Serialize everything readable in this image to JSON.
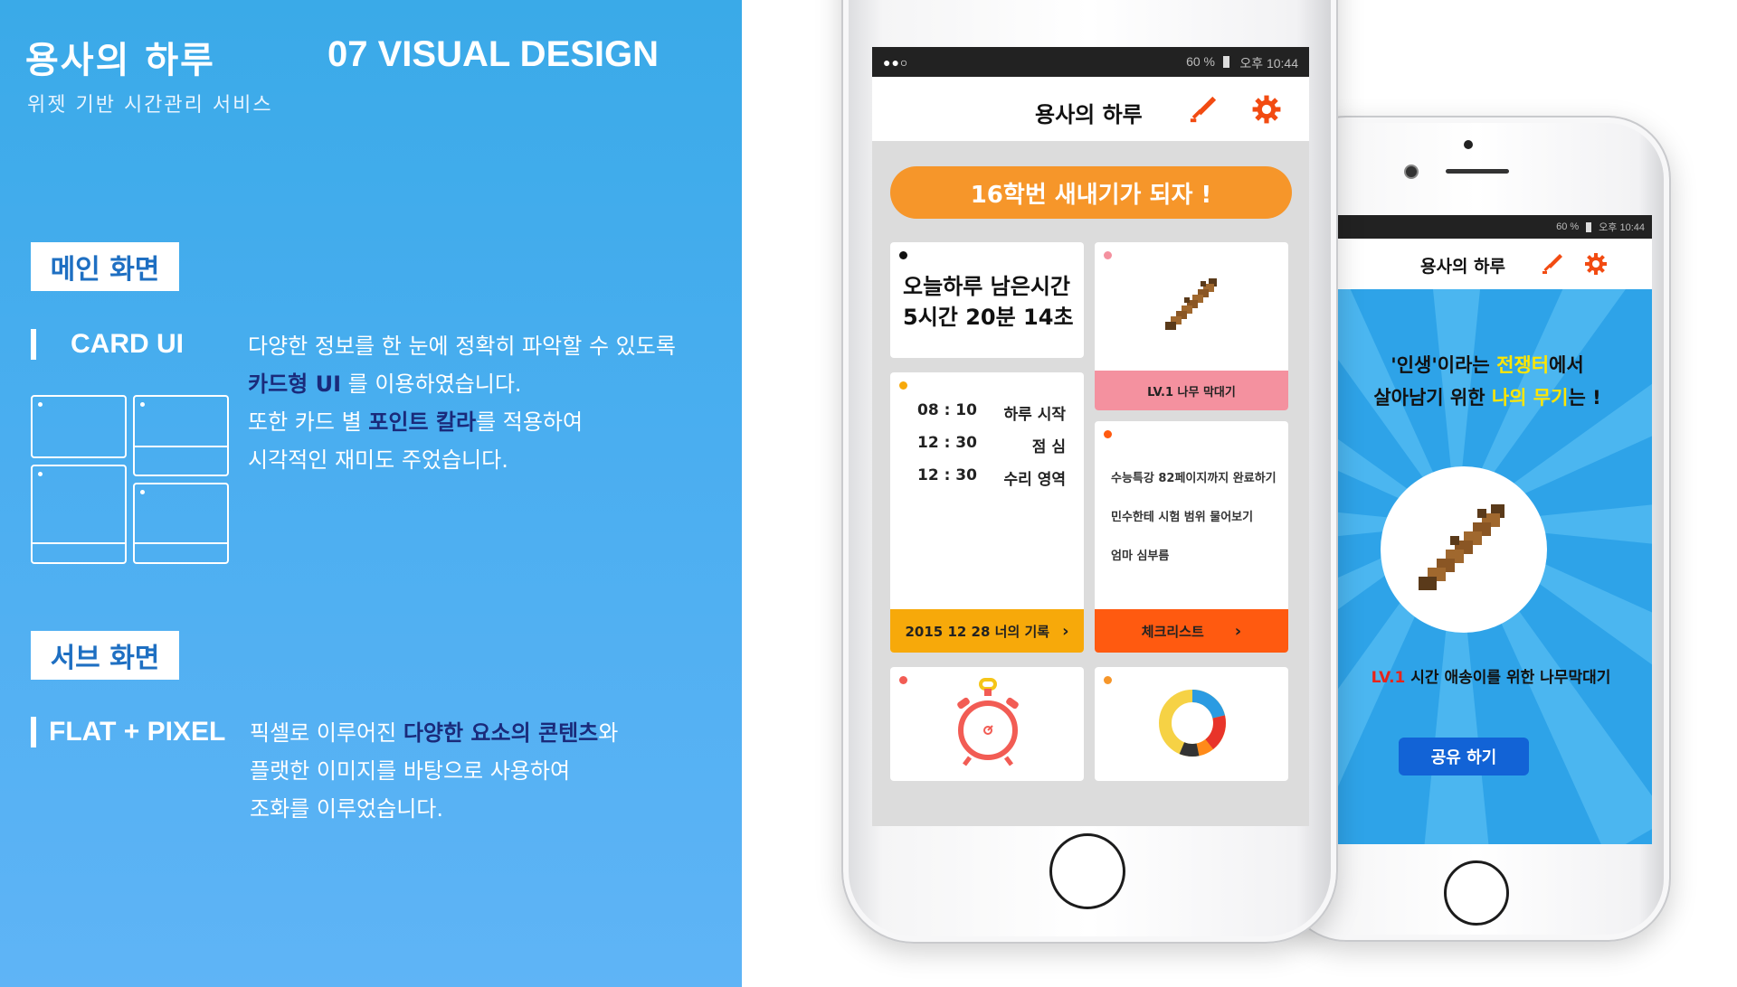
{
  "header": {
    "app_name": "용사의 하루",
    "section": "07 VISUAL DESIGN",
    "subtitle": "위젯 기반 시간관리 서비스"
  },
  "main_section": {
    "tag": "메인 화면",
    "feature": "CARD UI",
    "desc_l1": "다양한 정보를 한 눈에 정확히 파악할 수 있도록",
    "desc_l2_hl": "카드형 UI",
    "desc_l2_rest": " 를 이용하였습니다.",
    "desc_l3_pre": "또한 카드 별 ",
    "desc_l3_hl": "포인트 칼라",
    "desc_l3_rest": "를 적용하여",
    "desc_l4": "시각적인 재미도 주었습니다."
  },
  "sub_section": {
    "tag": "서브 화면",
    "feature": "FLAT + PIXEL",
    "desc_l1_pre": "픽셀로 이루어진 ",
    "desc_l1_hl": "다양한 요소의 콘텐츠",
    "desc_l1_rest": "와",
    "desc_l2": "플랫한 이미지를 바탕으로 사용하여",
    "desc_l3": "조화를 이루었습니다."
  },
  "phone_main": {
    "status_battery": "60 %",
    "status_time": "오후 10:44",
    "title": "용사의 하루",
    "banner": "16학번 새내기가 되자 !",
    "remaining_label": "오늘하루 남은시간",
    "remaining_value": "5시간 20분 14초",
    "weapon_label": "LV.1 나무 막대기",
    "schedule": [
      {
        "time": "08 : 10",
        "task": "하루 시작"
      },
      {
        "time": "12 : 30",
        "task": "점 심"
      },
      {
        "time": "12 : 30",
        "task": "수리 영역"
      }
    ],
    "record_button": "2015 12 28 너의 기록",
    "checklist": [
      "수능특강 82페이지까지 완료하기",
      "민수한테 시험 범위 물어보기",
      "엄마 심부름"
    ],
    "checklist_button": "체크리스트",
    "colors": {
      "banner": "#f6962a",
      "weapon_footer": "#f4919f",
      "record_footer": "#f7a90a",
      "checklist_footer": "#ff5a10",
      "accent": "#f24b12"
    }
  },
  "phone_sub": {
    "status_battery": "60 %",
    "status_time": "오후 10:44",
    "title": "용사의 하루",
    "line1_q1": "'인생'",
    "line1_mid": "이라는 ",
    "line1_hl": "전쟁터",
    "line1_end": "에서",
    "line2_pre": "살아남기 위한 ",
    "line2_hl": "나의 무기",
    "line2_end": "는 !",
    "level": "LV.1",
    "weapon_caption": " 시간 애송이를 위한 나무막대기",
    "share_button": "공유 하기",
    "colors": {
      "background": "#2ea3e8",
      "highlight": "#ffe600",
      "level": "#e8241a"
    }
  }
}
